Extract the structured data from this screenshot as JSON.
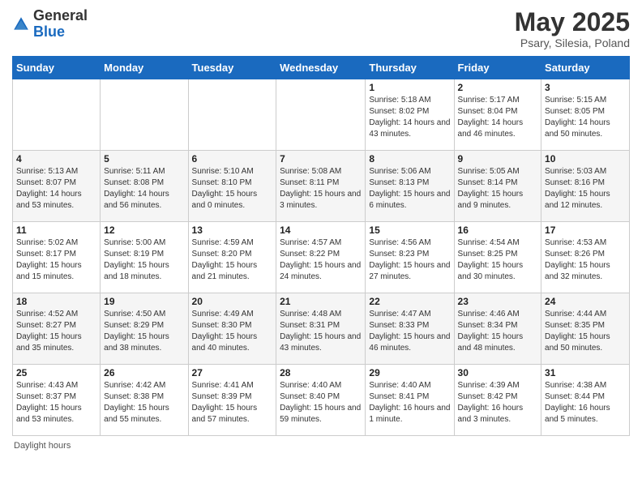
{
  "header": {
    "logo_general": "General",
    "logo_blue": "Blue",
    "month_year": "May 2025",
    "location": "Psary, Silesia, Poland"
  },
  "calendar": {
    "days_of_week": [
      "Sunday",
      "Monday",
      "Tuesday",
      "Wednesday",
      "Thursday",
      "Friday",
      "Saturday"
    ],
    "weeks": [
      [
        {
          "day": "",
          "info": ""
        },
        {
          "day": "",
          "info": ""
        },
        {
          "day": "",
          "info": ""
        },
        {
          "day": "",
          "info": ""
        },
        {
          "day": "1",
          "info": "Sunrise: 5:18 AM\nSunset: 8:02 PM\nDaylight: 14 hours and 43 minutes."
        },
        {
          "day": "2",
          "info": "Sunrise: 5:17 AM\nSunset: 8:04 PM\nDaylight: 14 hours and 46 minutes."
        },
        {
          "day": "3",
          "info": "Sunrise: 5:15 AM\nSunset: 8:05 PM\nDaylight: 14 hours and 50 minutes."
        }
      ],
      [
        {
          "day": "4",
          "info": "Sunrise: 5:13 AM\nSunset: 8:07 PM\nDaylight: 14 hours and 53 minutes."
        },
        {
          "day": "5",
          "info": "Sunrise: 5:11 AM\nSunset: 8:08 PM\nDaylight: 14 hours and 56 minutes."
        },
        {
          "day": "6",
          "info": "Sunrise: 5:10 AM\nSunset: 8:10 PM\nDaylight: 15 hours and 0 minutes."
        },
        {
          "day": "7",
          "info": "Sunrise: 5:08 AM\nSunset: 8:11 PM\nDaylight: 15 hours and 3 minutes."
        },
        {
          "day": "8",
          "info": "Sunrise: 5:06 AM\nSunset: 8:13 PM\nDaylight: 15 hours and 6 minutes."
        },
        {
          "day": "9",
          "info": "Sunrise: 5:05 AM\nSunset: 8:14 PM\nDaylight: 15 hours and 9 minutes."
        },
        {
          "day": "10",
          "info": "Sunrise: 5:03 AM\nSunset: 8:16 PM\nDaylight: 15 hours and 12 minutes."
        }
      ],
      [
        {
          "day": "11",
          "info": "Sunrise: 5:02 AM\nSunset: 8:17 PM\nDaylight: 15 hours and 15 minutes."
        },
        {
          "day": "12",
          "info": "Sunrise: 5:00 AM\nSunset: 8:19 PM\nDaylight: 15 hours and 18 minutes."
        },
        {
          "day": "13",
          "info": "Sunrise: 4:59 AM\nSunset: 8:20 PM\nDaylight: 15 hours and 21 minutes."
        },
        {
          "day": "14",
          "info": "Sunrise: 4:57 AM\nSunset: 8:22 PM\nDaylight: 15 hours and 24 minutes."
        },
        {
          "day": "15",
          "info": "Sunrise: 4:56 AM\nSunset: 8:23 PM\nDaylight: 15 hours and 27 minutes."
        },
        {
          "day": "16",
          "info": "Sunrise: 4:54 AM\nSunset: 8:25 PM\nDaylight: 15 hours and 30 minutes."
        },
        {
          "day": "17",
          "info": "Sunrise: 4:53 AM\nSunset: 8:26 PM\nDaylight: 15 hours and 32 minutes."
        }
      ],
      [
        {
          "day": "18",
          "info": "Sunrise: 4:52 AM\nSunset: 8:27 PM\nDaylight: 15 hours and 35 minutes."
        },
        {
          "day": "19",
          "info": "Sunrise: 4:50 AM\nSunset: 8:29 PM\nDaylight: 15 hours and 38 minutes."
        },
        {
          "day": "20",
          "info": "Sunrise: 4:49 AM\nSunset: 8:30 PM\nDaylight: 15 hours and 40 minutes."
        },
        {
          "day": "21",
          "info": "Sunrise: 4:48 AM\nSunset: 8:31 PM\nDaylight: 15 hours and 43 minutes."
        },
        {
          "day": "22",
          "info": "Sunrise: 4:47 AM\nSunset: 8:33 PM\nDaylight: 15 hours and 46 minutes."
        },
        {
          "day": "23",
          "info": "Sunrise: 4:46 AM\nSunset: 8:34 PM\nDaylight: 15 hours and 48 minutes."
        },
        {
          "day": "24",
          "info": "Sunrise: 4:44 AM\nSunset: 8:35 PM\nDaylight: 15 hours and 50 minutes."
        }
      ],
      [
        {
          "day": "25",
          "info": "Sunrise: 4:43 AM\nSunset: 8:37 PM\nDaylight: 15 hours and 53 minutes."
        },
        {
          "day": "26",
          "info": "Sunrise: 4:42 AM\nSunset: 8:38 PM\nDaylight: 15 hours and 55 minutes."
        },
        {
          "day": "27",
          "info": "Sunrise: 4:41 AM\nSunset: 8:39 PM\nDaylight: 15 hours and 57 minutes."
        },
        {
          "day": "28",
          "info": "Sunrise: 4:40 AM\nSunset: 8:40 PM\nDaylight: 15 hours and 59 minutes."
        },
        {
          "day": "29",
          "info": "Sunrise: 4:40 AM\nSunset: 8:41 PM\nDaylight: 16 hours and 1 minute."
        },
        {
          "day": "30",
          "info": "Sunrise: 4:39 AM\nSunset: 8:42 PM\nDaylight: 16 hours and 3 minutes."
        },
        {
          "day": "31",
          "info": "Sunrise: 4:38 AM\nSunset: 8:44 PM\nDaylight: 16 hours and 5 minutes."
        }
      ]
    ]
  },
  "footer": {
    "note": "Daylight hours"
  }
}
